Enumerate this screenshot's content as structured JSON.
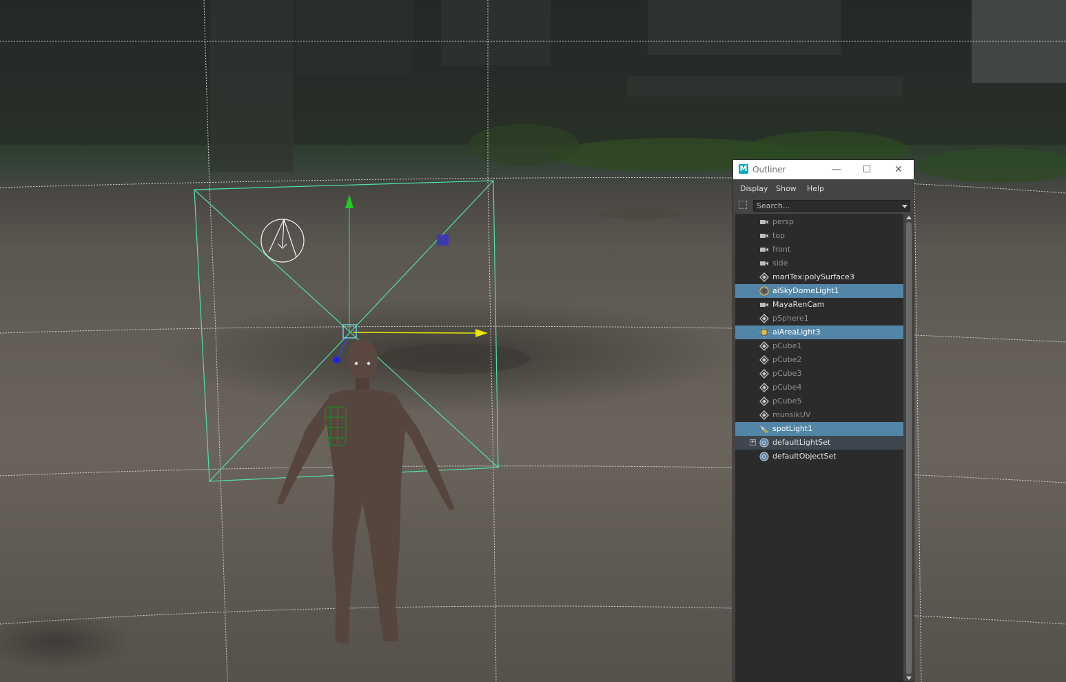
{
  "outliner": {
    "title": "Outliner",
    "window_controls": {
      "minimize": "—",
      "maximize": "☐",
      "close": "✕"
    },
    "menus": [
      "Display",
      "Show",
      "Help"
    ],
    "search": {
      "placeholder": "Search..."
    },
    "items": [
      {
        "label": "persp",
        "icon": "camera-icon",
        "state": "dim"
      },
      {
        "label": "top",
        "icon": "camera-icon",
        "state": "dim"
      },
      {
        "label": "front",
        "icon": "camera-icon",
        "state": "dim"
      },
      {
        "label": "side",
        "icon": "camera-icon",
        "state": "dim"
      },
      {
        "label": "mariTex:polySurface3",
        "icon": "transform-icon",
        "state": "bright"
      },
      {
        "label": "aiSkyDomeLight1",
        "icon": "skydome-light-icon",
        "state": "selected"
      },
      {
        "label": "MayaRenCam",
        "icon": "camera-icon",
        "state": "bright"
      },
      {
        "label": "pSphere1",
        "icon": "transform-icon",
        "state": "dim"
      },
      {
        "label": "aiAreaLight3",
        "icon": "area-light-icon",
        "state": "selected"
      },
      {
        "label": "pCube1",
        "icon": "transform-icon",
        "state": "dim"
      },
      {
        "label": "pCube2",
        "icon": "transform-icon",
        "state": "dim"
      },
      {
        "label": "pCube3",
        "icon": "transform-icon",
        "state": "dim"
      },
      {
        "label": "pCube4",
        "icon": "transform-icon",
        "state": "dim"
      },
      {
        "label": "pCube5",
        "icon": "transform-icon",
        "state": "dim"
      },
      {
        "label": "munsikUV",
        "icon": "transform-icon",
        "state": "dim"
      },
      {
        "label": "spotLight1",
        "icon": "spot-light-icon",
        "state": "selected"
      },
      {
        "label": "defaultLightSet",
        "icon": "set-icon",
        "state": "highlight",
        "expandable": true
      },
      {
        "label": "defaultObjectSet",
        "icon": "set-icon",
        "state": "bright"
      }
    ],
    "colors": {
      "selection": "#5285a6",
      "highlight": "#3e4650",
      "panel_bg": "#444444",
      "list_bg": "#2b2b2b"
    }
  },
  "viewport": {
    "gizmo_colors": {
      "light_outline": "#4fe3a8",
      "y_axis": "#22cc22",
      "x_axis": "#e8e800",
      "z_axis": "#2222dd",
      "grid": "#f0f0f0"
    }
  }
}
